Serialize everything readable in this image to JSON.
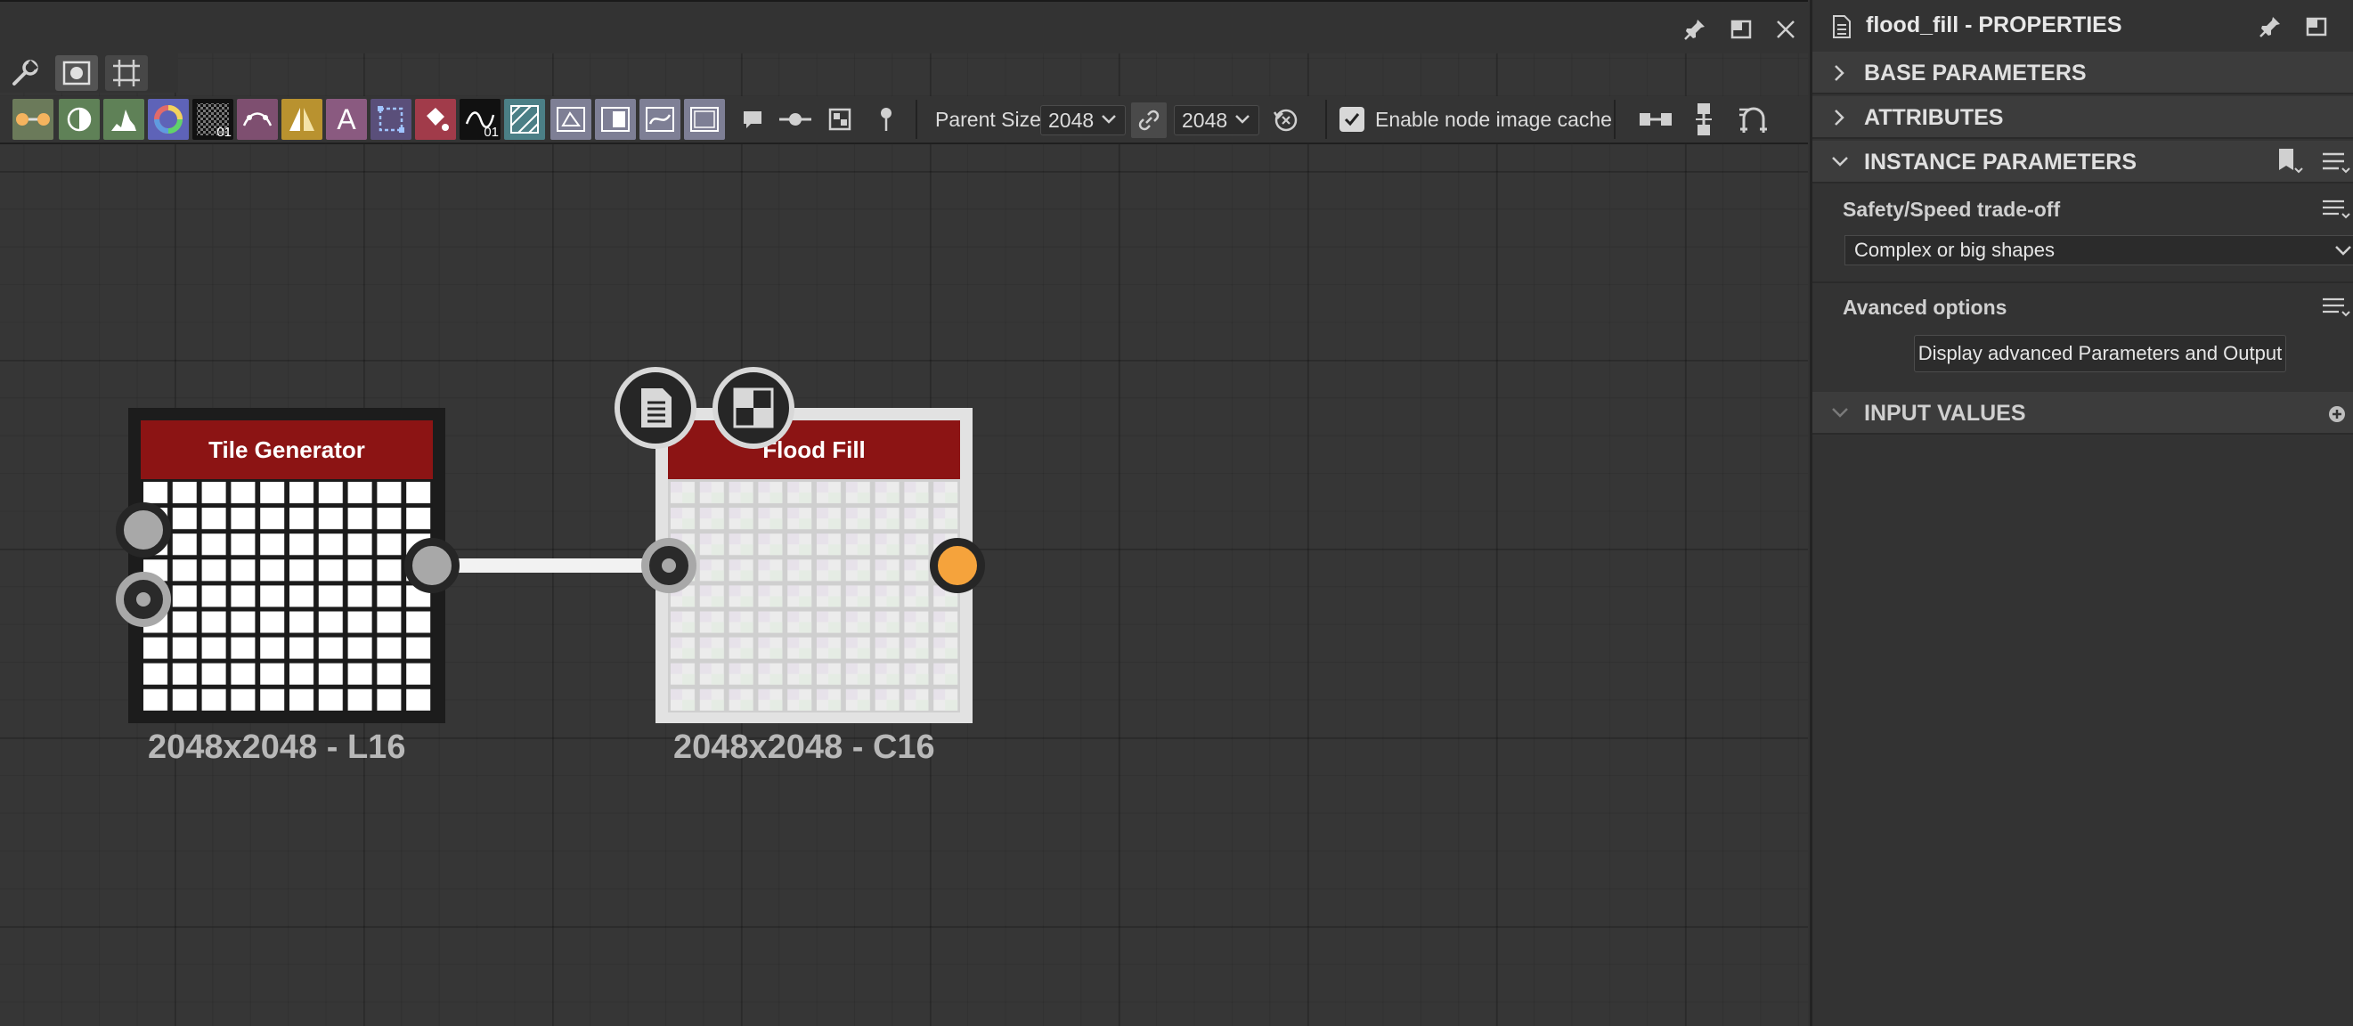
{
  "graph": {
    "toolbar": {
      "parent_size_label": "Parent Size:",
      "width_value": "2048",
      "height_value": "2048",
      "image_cache_label": "Enable node image cache",
      "image_cache_checked": true,
      "tile_icon_label": "01",
      "curve_icon_label": "01",
      "text_icon_label": "A"
    },
    "nodes": [
      {
        "title": "Tile Generator",
        "subtitle": "2048x2048 - L16"
      },
      {
        "title": "Flood Fill",
        "subtitle": "2048x2048 - C16"
      }
    ],
    "colors": {
      "node_title": "#8c1414",
      "output_port_active": "#f5a33c",
      "canvas": "#363636"
    }
  },
  "properties": {
    "title": "flood_fill - PROPERTIES",
    "sections": {
      "base": "BASE PARAMETERS",
      "attributes": "ATTRIBUTES",
      "instance": "INSTANCE PARAMETERS",
      "inputs": "INPUT VALUES"
    },
    "params": {
      "safety_label": "Safety/Speed trade-off",
      "safety_value": "Complex or big shapes",
      "advanced_label": "Avanced options",
      "advanced_button": "Display advanced Parameters and Output"
    }
  }
}
